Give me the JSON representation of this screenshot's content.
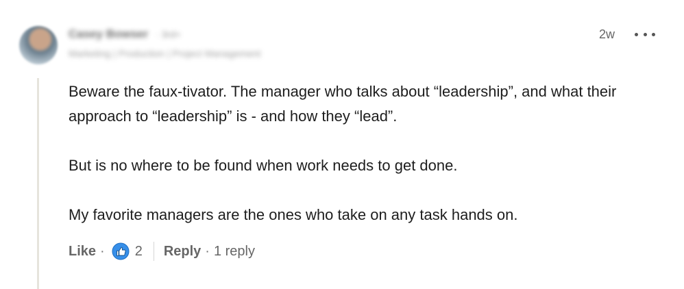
{
  "author": {
    "name": "Casey Bowser",
    "degree": "· 3rd+",
    "headline": "Marketing | Production | Project Management"
  },
  "meta": {
    "timestamp": "2w",
    "more_icon": "more-horizontal-icon"
  },
  "body": {
    "paragraphs": [
      "Beware the faux-tivator. The manager who talks about “leadership”, and what their approach to “leadership” is - and how they “lead”.",
      "But is no where to be found when work needs to get done.",
      "My favorite managers are the ones who take on any task hands on."
    ]
  },
  "actions": {
    "like_label": "Like",
    "separator": "·",
    "reaction_icon": "thumbs-up-icon",
    "reaction_count": "2",
    "reply_label": "Reply",
    "reply_count_label": "1 reply"
  },
  "colors": {
    "like_icon_blue": "#378fe9",
    "thread_line": "#e6e4dc",
    "muted_text": "#666666"
  }
}
